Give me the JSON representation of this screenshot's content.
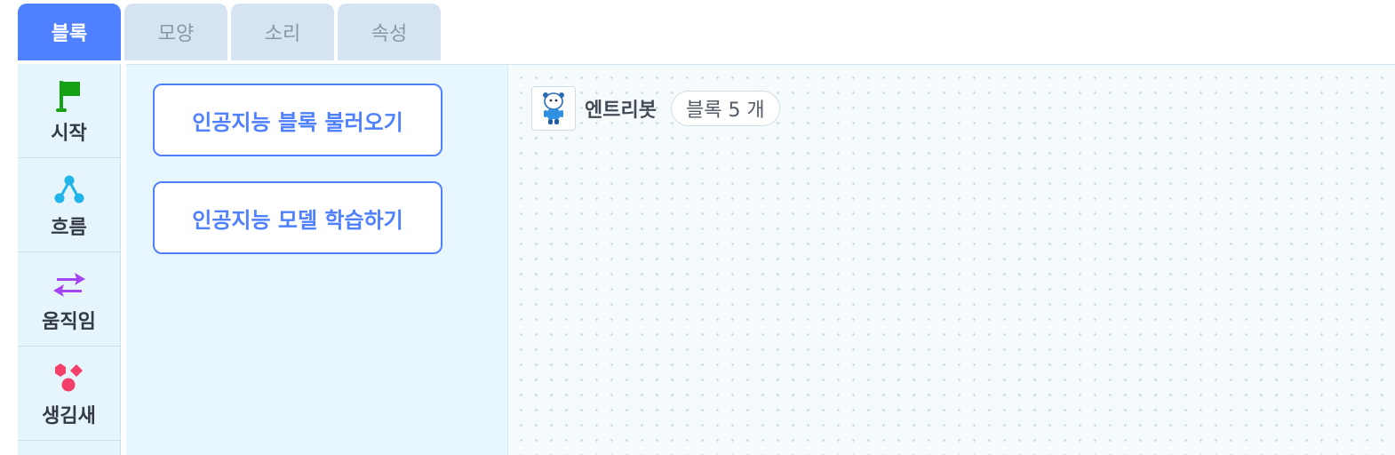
{
  "tabs": [
    {
      "label": "블록",
      "active": true
    },
    {
      "label": "모양",
      "active": false
    },
    {
      "label": "소리",
      "active": false
    },
    {
      "label": "속성",
      "active": false
    }
  ],
  "categories": [
    {
      "label": "시작",
      "icon": "flag-icon",
      "color": "#15a113"
    },
    {
      "label": "흐름",
      "icon": "flow-icon",
      "color": "#20b4e8"
    },
    {
      "label": "움직임",
      "icon": "move-arrows-icon",
      "color": "#a445f2"
    },
    {
      "label": "생김새",
      "icon": "shapes-icon",
      "color": "#f2406a"
    }
  ],
  "palette": {
    "buttons": [
      {
        "label": "인공지능 블록 불러오기"
      },
      {
        "label": "인공지능 모델 학습하기"
      }
    ]
  },
  "workspace": {
    "object_name": "엔트리봇",
    "block_count": "블록 5 개"
  },
  "colors": {
    "accent": "#4f80ff",
    "tab_inactive": "#d5e4f0",
    "palette_bg": "#e8f6fd"
  }
}
